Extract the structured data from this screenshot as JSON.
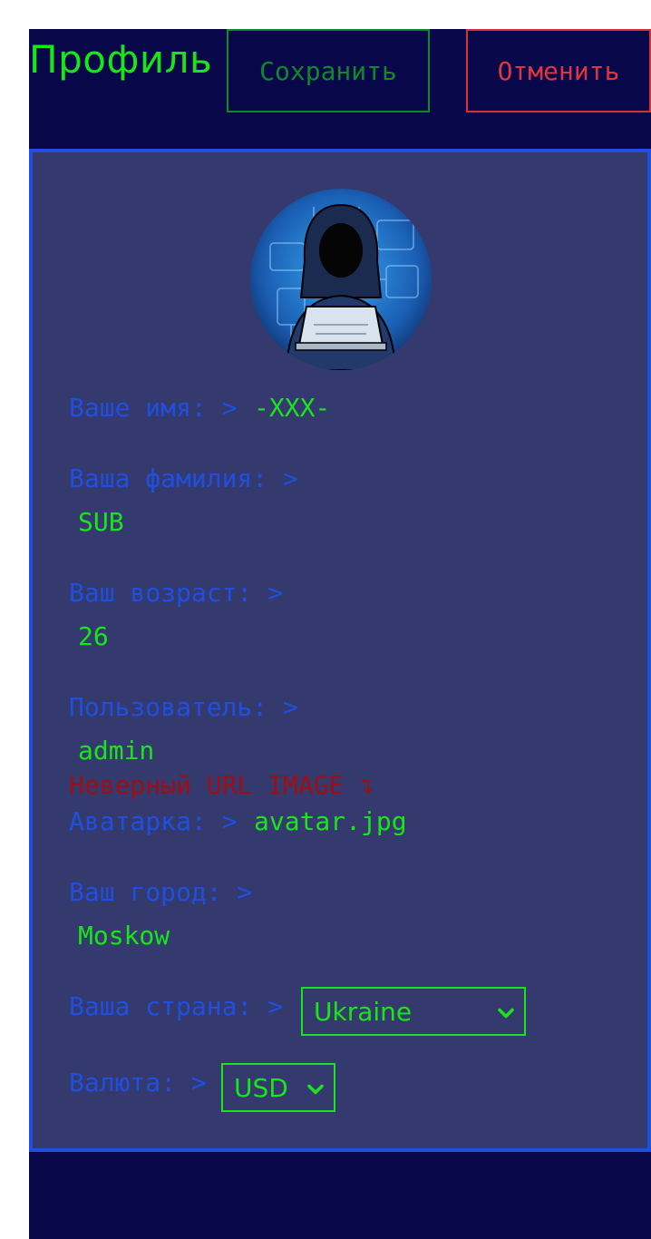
{
  "header": {
    "title": "Профиль",
    "save_label": "Сохранить",
    "cancel_label": "Отменить"
  },
  "profile": {
    "name_label": "Ваше имя: >",
    "name_value": "-XXX-",
    "surname_label": "Ваша фамилия: >",
    "surname_value": "SUB",
    "age_label": "Ваш возраст: >",
    "age_value": "26",
    "user_label": "Пользователь: >",
    "user_value": "admin",
    "image_error": "Неверный URL IMAGE ↴",
    "avatar_label": "Аватарка: >",
    "avatar_value": "avatar.jpg",
    "city_label": "Ваш город: >",
    "city_value": "Moskow",
    "country_label": "Ваша страна: >",
    "country_value": "Ukraine",
    "currency_label": "Валюта: >",
    "currency_value": "USD"
  },
  "colors": {
    "page_bg": "#070749",
    "panel_bg": "#343a6e",
    "accent_blue": "#1f4fe0",
    "value_green": "#19e619",
    "save_green": "#0e8a2a",
    "cancel_red": "#e0353f",
    "error_red": "#a00d12"
  },
  "icons": {
    "avatar": "hooded-hacker-avatar",
    "select_chevron": "chevron-down-icon"
  }
}
